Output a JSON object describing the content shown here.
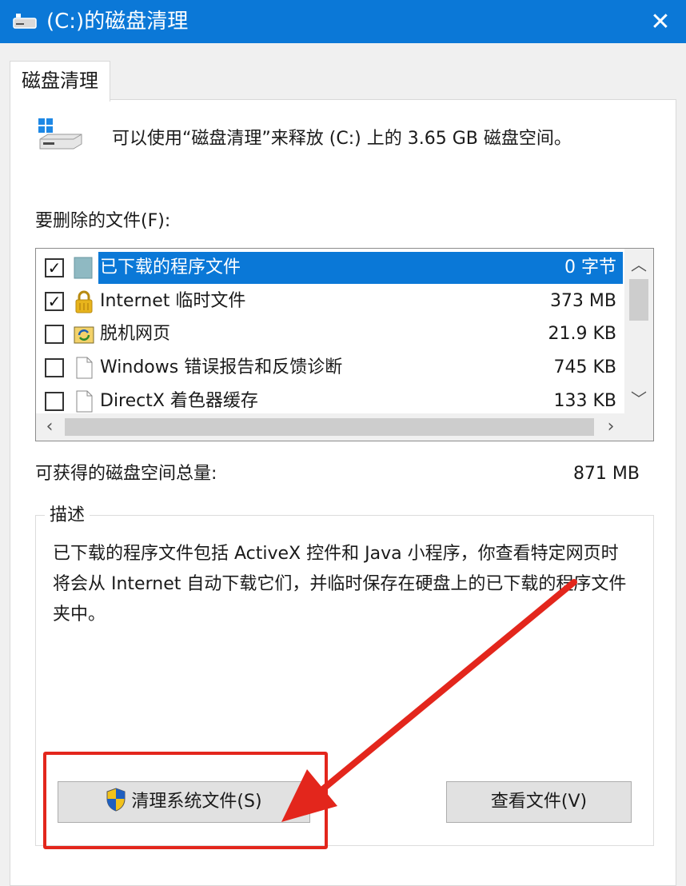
{
  "window": {
    "title": "(C:)的磁盘清理",
    "close_glyph": "✕"
  },
  "tab": {
    "label": "磁盘清理"
  },
  "intro": {
    "text": "可以使用“磁盘清理”来释放 (C:) 上的 3.65 GB 磁盘空间。"
  },
  "files": {
    "label": "要删除的文件(F):",
    "items": [
      {
        "checked": true,
        "icon": "folder-icon",
        "name": "已下载的程序文件",
        "size": "0 字节",
        "selected": true
      },
      {
        "checked": true,
        "icon": "lock-icon",
        "name": "Internet 临时文件",
        "size": "373 MB",
        "selected": false
      },
      {
        "checked": false,
        "icon": "offline-pages-icon",
        "name": "脱机网页",
        "size": "21.9 KB",
        "selected": false
      },
      {
        "checked": false,
        "icon": "document-icon",
        "name": "Windows 错误报告和反馈诊断",
        "size": "745 KB",
        "selected": false
      },
      {
        "checked": false,
        "icon": "document-icon",
        "name": "DirectX 着色器缓存",
        "size": "133 KB",
        "selected": false
      }
    ]
  },
  "total": {
    "label": "可获得的磁盘空间总量:",
    "value": "871 MB"
  },
  "description": {
    "legend": "描述",
    "text": "已下载的程序文件包括 ActiveX 控件和 Java 小程序，你查看特定网页时将会从 Internet 自动下载它们，并临时保存在硬盘上的已下载的程序文件夹中。"
  },
  "buttons": {
    "clean_system": "清理系统文件(S)",
    "view_files": "查看文件(V)"
  },
  "annotation": {
    "color": "#e3261c"
  }
}
